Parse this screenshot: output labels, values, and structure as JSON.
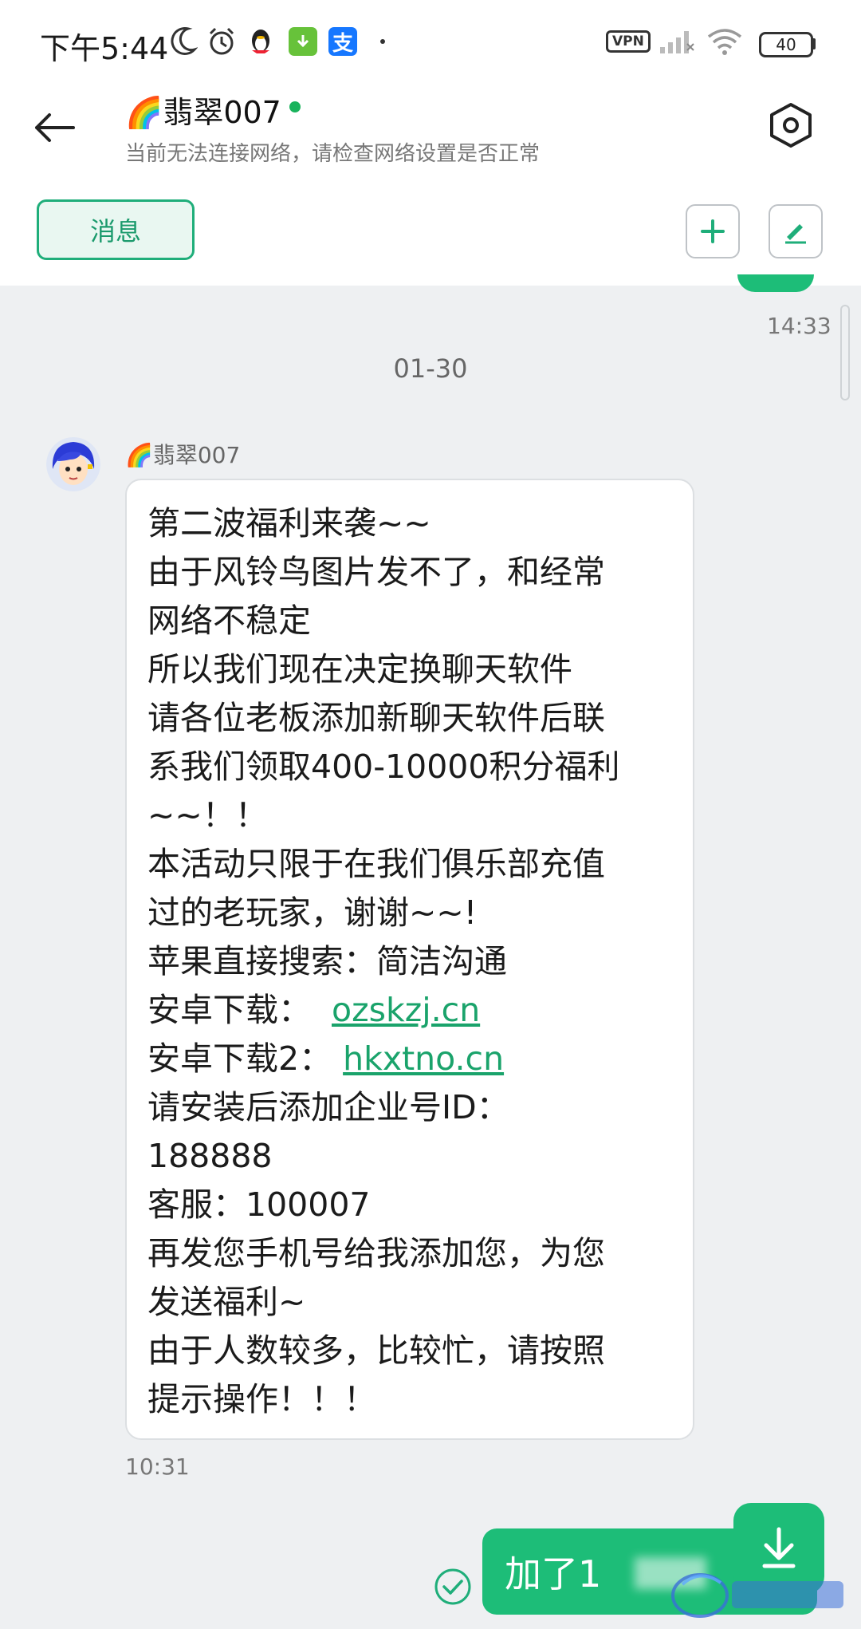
{
  "status_bar": {
    "time": "下午5:44",
    "vpn_label": "VPN",
    "battery": "40",
    "icons": [
      "moon-icon",
      "alarm-icon",
      "qq-penguin-icon",
      "download-app-icon",
      "alipay-icon",
      "dot-icon",
      "vpn-icon",
      "signal-icon",
      "wifi-icon",
      "battery-icon"
    ],
    "alipay_glyph": "支"
  },
  "header": {
    "title": "🌈翡翠007",
    "subtitle": "当前无法连接网络，请检查网络设置是否正常"
  },
  "toolbar": {
    "tab_label": "消息"
  },
  "chat": {
    "prev_time": "14:33",
    "date_separator": "01-30",
    "sender_name": "🌈翡翠007",
    "message_lines": [
      "第二波福利来袭~~",
      "由于风铃鸟图片发不了，和经常",
      "网络不稳定",
      "所以我们现在决定换聊天软件",
      "请各位老板添加新聊天软件后联",
      "系我们领取400-10000积分福利",
      "~~！！",
      "本活动只限于在我们俱乐部充值",
      "过的老玩家，谢谢~~!",
      "苹果直接搜索：简洁沟通"
    ],
    "download1_label": "安卓下载：",
    "download1_link": "ozskzj.cn",
    "download2_label": "安卓下载2：",
    "download2_link": "hkxtno.cn",
    "message_lines_2": [
      "请安装后添加企业号ID：",
      "188888",
      "客服：100007",
      "再发您手机号给我添加您，为您",
      "发送福利~",
      "由于人数较多，比较忙，请按照",
      "提示操作！！！"
    ],
    "message_time": "10:31",
    "outgoing_text": "加了1"
  },
  "colors": {
    "accent": "#1dbd78",
    "link": "#1aa36b",
    "online": "#19b35c"
  }
}
